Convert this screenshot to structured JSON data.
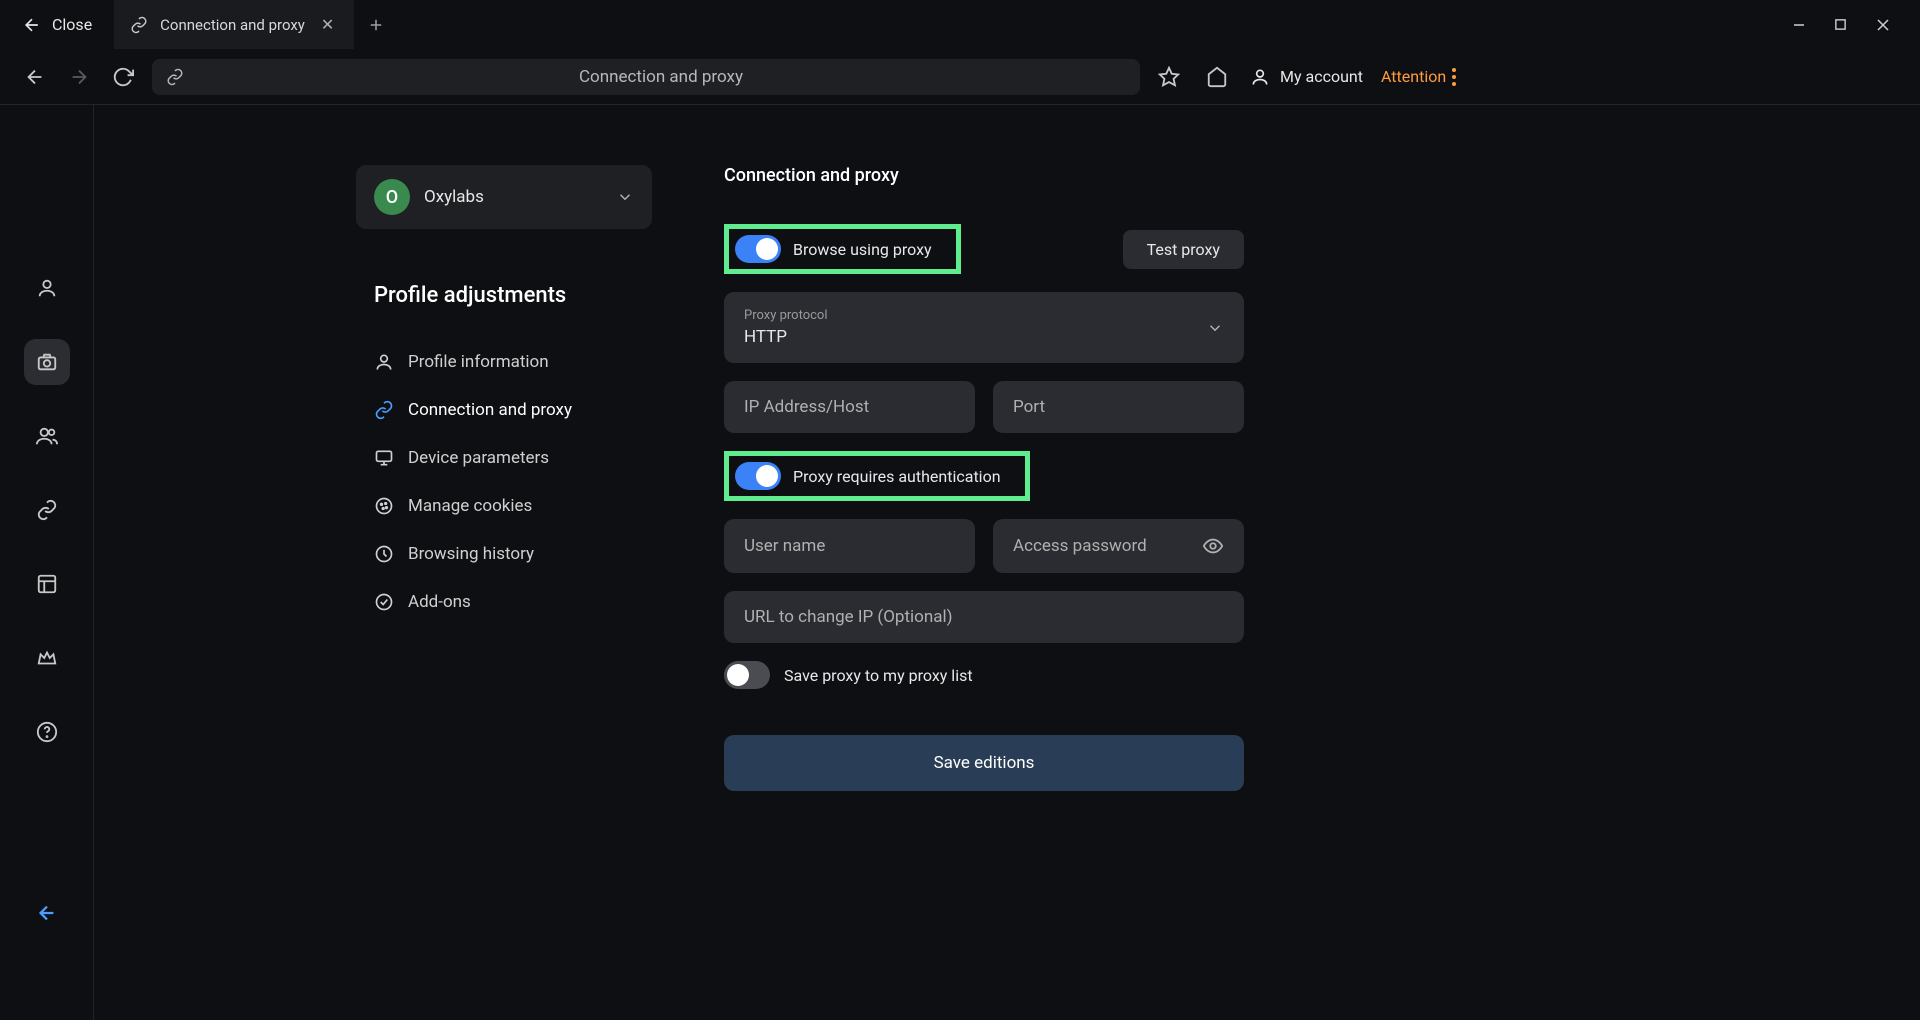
{
  "titlebar": {
    "close_label": "Close",
    "tab_label": "Connection and proxy"
  },
  "toolbar": {
    "omnibox_text": "Connection and proxy",
    "account_label": "My account",
    "attention_label": "Attention"
  },
  "profile": {
    "avatar_letter": "O",
    "name": "Oxylabs"
  },
  "sidebar": {
    "section_title": "Profile adjustments",
    "items": [
      {
        "label": "Profile information"
      },
      {
        "label": "Connection and proxy"
      },
      {
        "label": "Device parameters"
      },
      {
        "label": "Manage cookies"
      },
      {
        "label": "Browsing history"
      },
      {
        "label": "Add-ons"
      }
    ]
  },
  "panel": {
    "title": "Connection and proxy",
    "browse_using_proxy": "Browse using proxy",
    "test_proxy": "Test proxy",
    "proxy_protocol_label": "Proxy protocol",
    "proxy_protocol_value": "HTTP",
    "ip_host_placeholder": "IP Address/Host",
    "port_placeholder": "Port",
    "proxy_auth_label": "Proxy requires authentication",
    "username_placeholder": "User name",
    "password_placeholder": "Access password",
    "url_change_ip_placeholder": "URL to change IP (Optional)",
    "save_to_list_label": "Save proxy to my proxy list",
    "save_button": "Save editions"
  }
}
